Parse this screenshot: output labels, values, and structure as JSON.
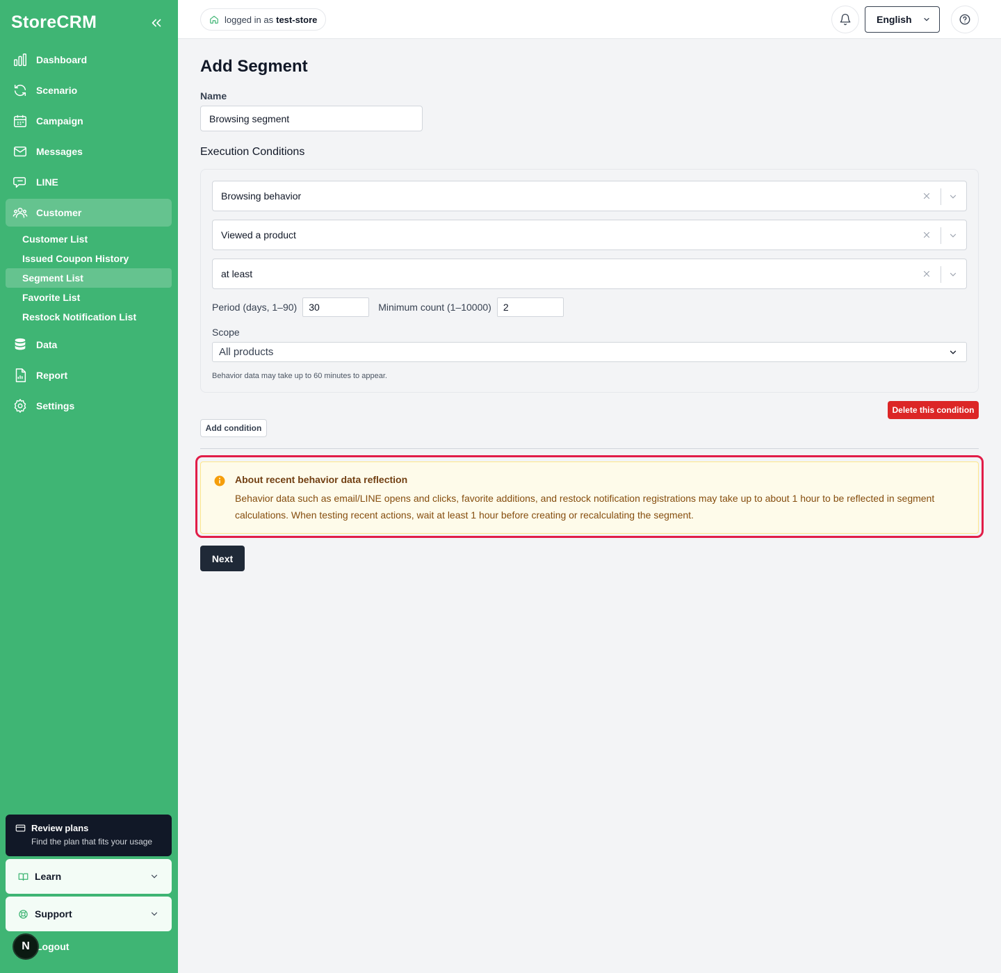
{
  "brand": "StoreCRM",
  "sidebar": {
    "items": [
      {
        "label": "Dashboard",
        "icon": "bar-chart-icon"
      },
      {
        "label": "Scenario",
        "icon": "refresh-icon"
      },
      {
        "label": "Campaign",
        "icon": "calendar-icon"
      },
      {
        "label": "Messages",
        "icon": "mail-icon"
      },
      {
        "label": "LINE",
        "icon": "chat-icon"
      },
      {
        "label": "Customer",
        "icon": "users-icon"
      }
    ],
    "customer_sub": [
      "Customer List",
      "Issued Coupon History",
      "Segment List",
      "Favorite List",
      "Restock Notification List"
    ],
    "items_after": [
      {
        "label": "Data",
        "icon": "database-icon"
      },
      {
        "label": "Report",
        "icon": "document-icon"
      },
      {
        "label": "Settings",
        "icon": "gear-icon"
      }
    ],
    "plans": {
      "title": "Review plans",
      "subtitle": "Find the plan that fits your usage"
    },
    "learn": "Learn",
    "support": "Support",
    "avatar_initial": "N",
    "logout": "Logout"
  },
  "header": {
    "logged_in_prefix": "logged in as",
    "store": "test-store",
    "language": "English"
  },
  "page": {
    "title": "Add Segment",
    "name_label": "Name",
    "name_value": "Browsing segment",
    "conditions_title": "Execution Conditions",
    "condition": {
      "type": "Browsing behavior",
      "event": "Viewed a product",
      "comparator": "at least",
      "period_label": "Period (days, 1–90)",
      "period_value": "30",
      "min_label": "Minimum count (1–10000)",
      "min_value": "2",
      "scope_label": "Scope",
      "scope_value": "All products",
      "helper": "Behavior data may take up to 60 minutes to appear."
    },
    "delete_condition": "Delete this condition",
    "add_condition": "Add condition",
    "alert": {
      "title": "About recent behavior data reflection",
      "body": "Behavior data such as email/LINE opens and clicks, favorite additions, and restock notification registrations may take up to about 1 hour to be reflected in segment calculations. When testing recent actions, wait at least 1 hour before creating or recalculating the segment."
    },
    "next": "Next"
  },
  "colors": {
    "sidebar": "#3fb574",
    "danger": "#dc2626",
    "highlight_ring": "#e11d48",
    "alert_bg": "#fefbea",
    "primary_dark": "#1f2937"
  }
}
